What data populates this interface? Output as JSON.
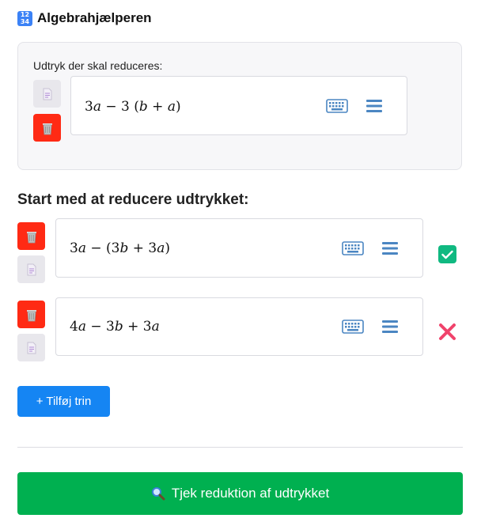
{
  "app": {
    "title": "Algebrahjælperen",
    "icon": "number-grid-icon",
    "icon_text_top": "12",
    "icon_text_bottom": "34"
  },
  "expression_panel": {
    "label": "Udtryk der skal reduceres:",
    "expression": "3a − 3 (b + a)",
    "actions": [
      "document-icon",
      "trash-icon"
    ]
  },
  "steps_section": {
    "title": "Start med at reducere udtrykket:"
  },
  "steps": [
    {
      "expression": "3a − (3b + 3a)",
      "status": "correct",
      "status_icon": "checkmark-icon"
    },
    {
      "expression": "4a − 3b + 3a",
      "status": "incorrect",
      "status_icon": "cross-icon"
    }
  ],
  "add_step": {
    "label": "+ Tilføj trin"
  },
  "check": {
    "label": "Tjek reduktion af udtrykket",
    "icon": "magnifier-icon"
  },
  "colors": {
    "primary": "#1585f3",
    "success": "#00b050",
    "danger": "#ff2a14",
    "check_badge": "#10b981",
    "cross": "#f0436b",
    "icon_blue": "#4b86c2"
  }
}
